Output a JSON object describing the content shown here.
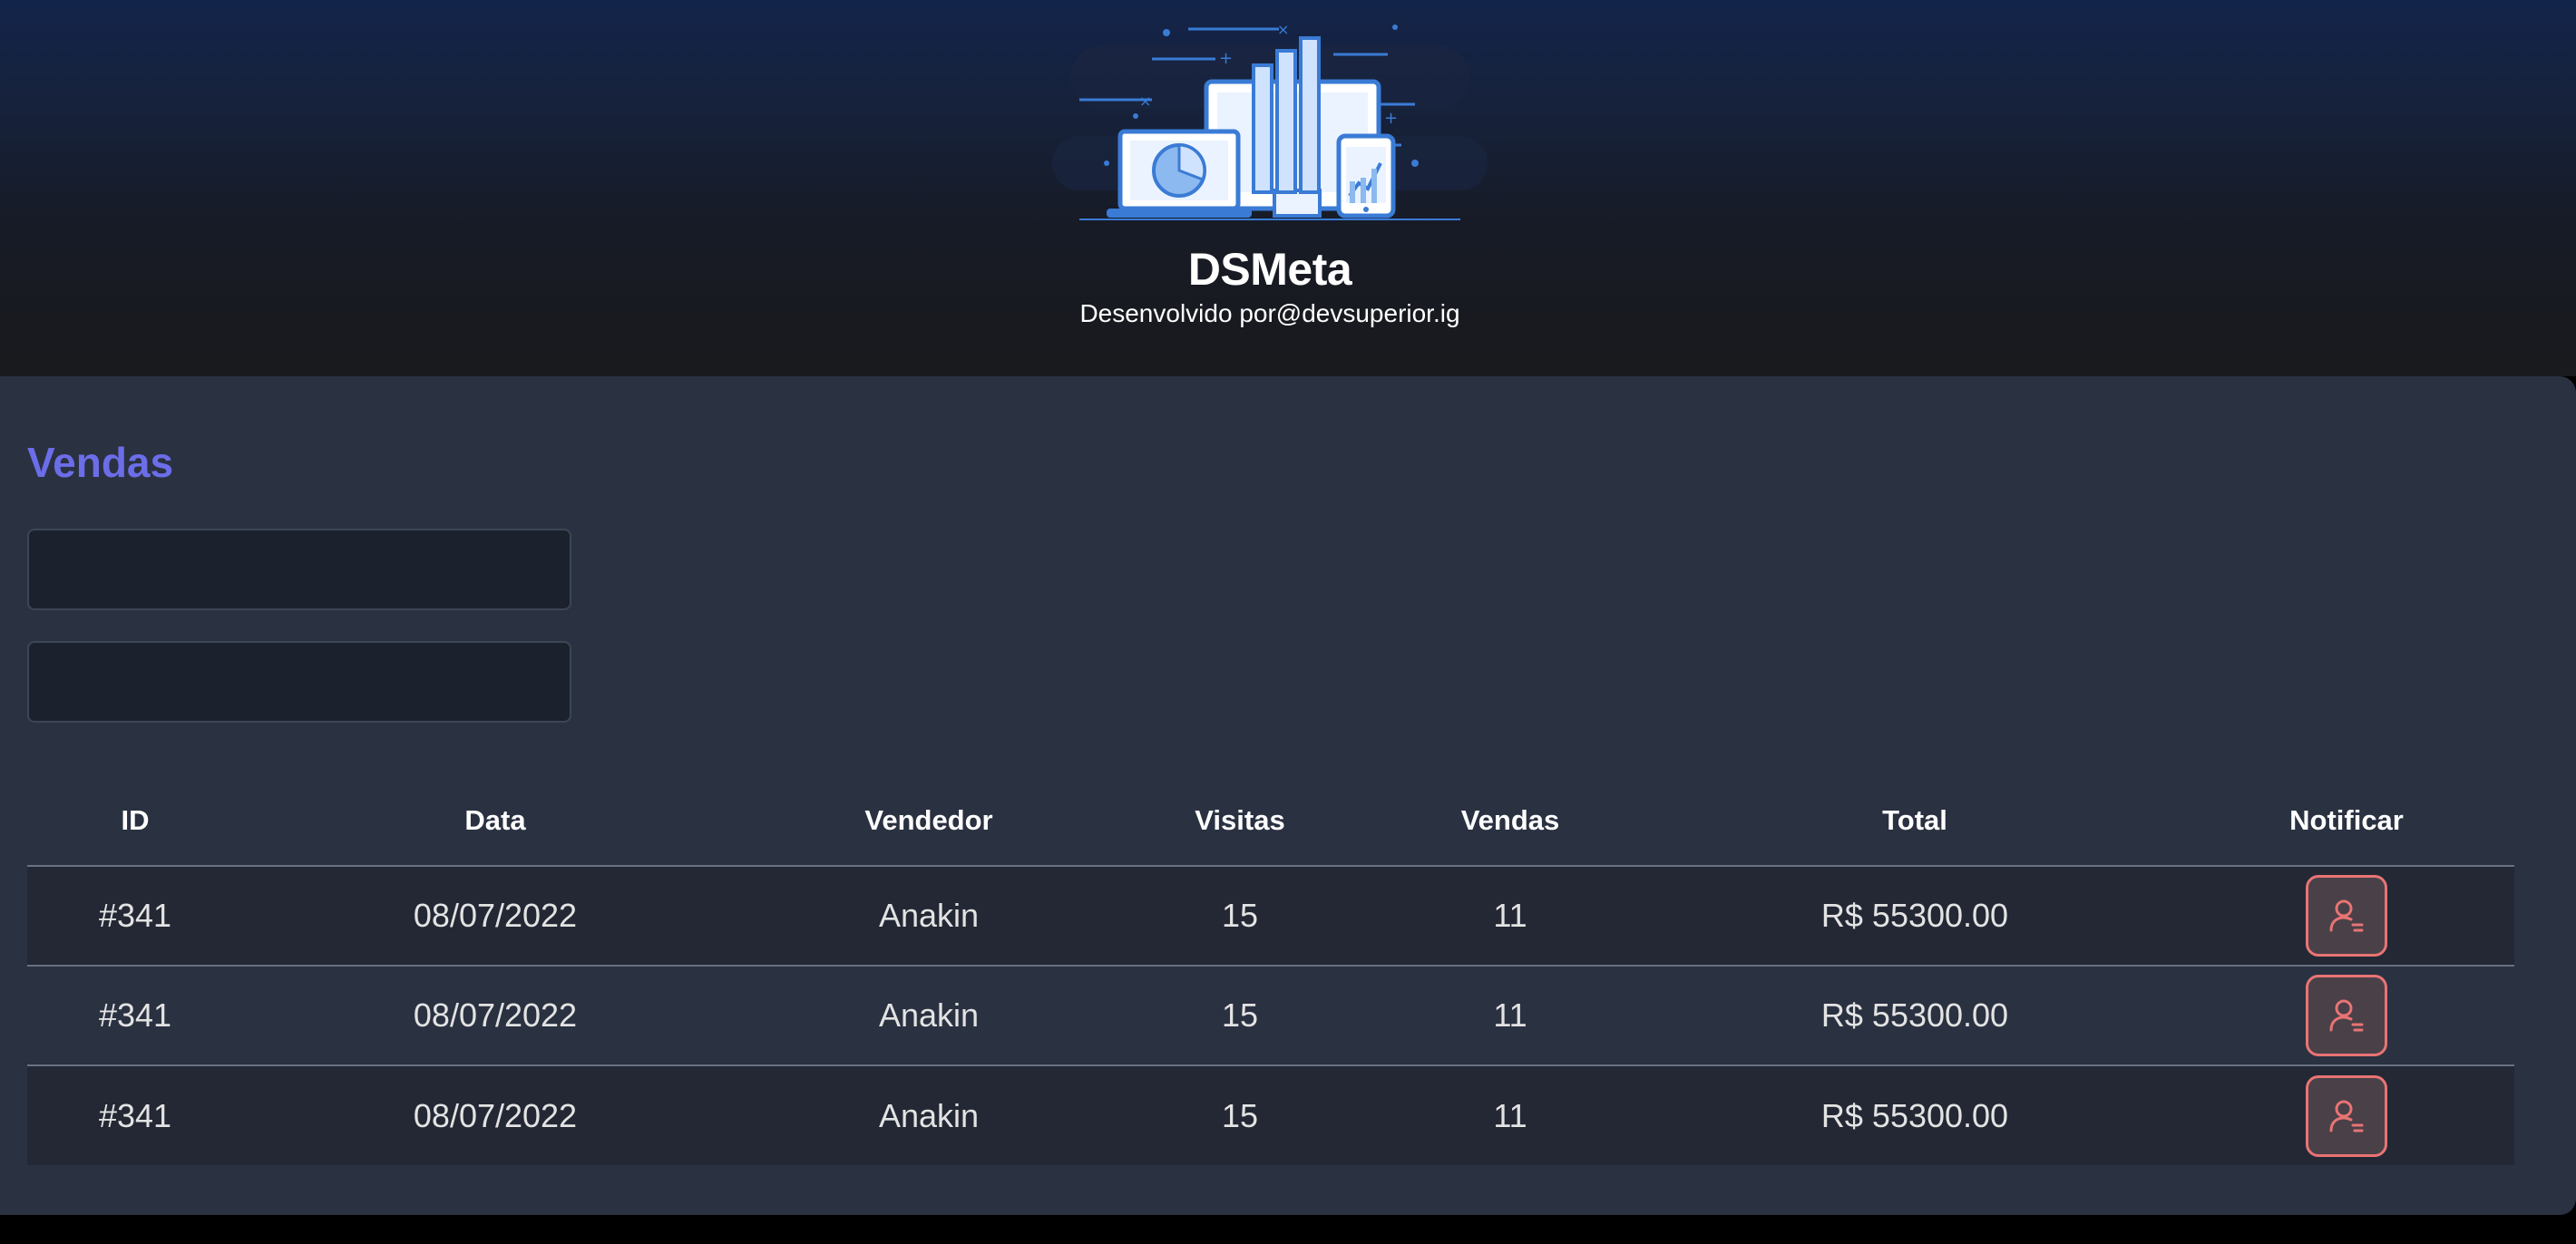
{
  "header": {
    "title": "DSMeta",
    "subtitle": "Desenvolvido por@devsuperior.ig",
    "logo_icon": "dashboard-devices-illustration"
  },
  "sales": {
    "title": "Vendas",
    "min_date": {
      "value": "",
      "placeholder": ""
    },
    "max_date": {
      "value": "",
      "placeholder": ""
    },
    "columns": [
      "ID",
      "Data",
      "Vendedor",
      "Visitas",
      "Vendas",
      "Total",
      "Notificar"
    ],
    "rows": [
      {
        "id": "#341",
        "date": "08/07/2022",
        "seller": "Anakin",
        "visits": "15",
        "deals": "11",
        "amount": "R$ 55300.00"
      },
      {
        "id": "#341",
        "date": "08/07/2022",
        "seller": "Anakin",
        "visits": "15",
        "deals": "11",
        "amount": "R$ 55300.00"
      },
      {
        "id": "#341",
        "date": "08/07/2022",
        "seller": "Anakin",
        "visits": "15",
        "deals": "11",
        "amount": "R$ 55300.00"
      }
    ],
    "notify_icon": "user-notify-icon"
  },
  "colors": {
    "accent": "#6c6de8",
    "card_background": "#2a3141",
    "notify_border": "#e87474",
    "header_top": "#13244a"
  }
}
